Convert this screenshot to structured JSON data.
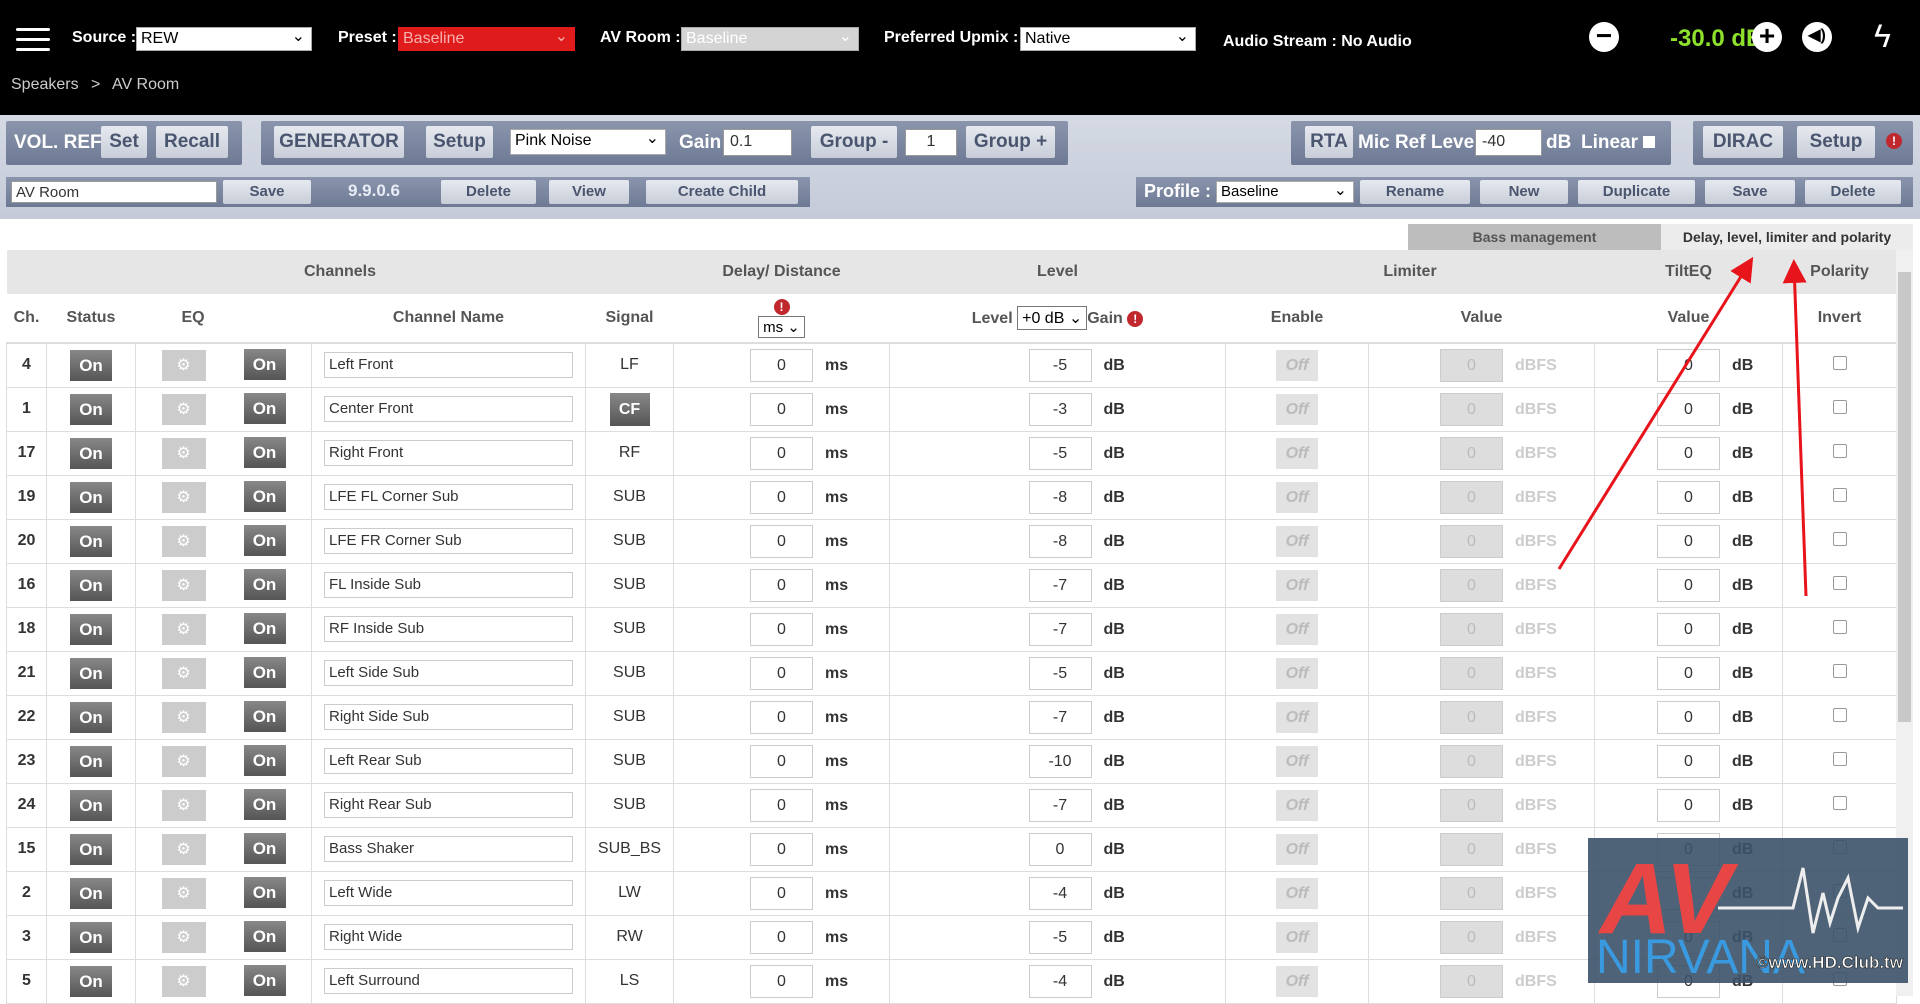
{
  "header": {
    "source_label": "Source :",
    "source": "REW",
    "preset_label": "Preset :",
    "preset": "Baseline",
    "av_room_label": "AV Room :",
    "av_room": "Baseline",
    "upmix_label": "Preferred Upmix :",
    "upmix": "Native",
    "audio_stream": "Audio Stream : No Audio",
    "volume": "-30.0 dB",
    "minus": "−",
    "plus": "+"
  },
  "breadcrumb": {
    "root": "Speakers",
    "sep": ">",
    "current": "AV Room"
  },
  "toolbar": {
    "vol_ref": "VOL. REF",
    "set": "Set",
    "recall": "Recall",
    "generator": "GENERATOR",
    "gen_setup": "Setup",
    "noise": "Pink Noise",
    "gain_label": "Gain",
    "gain": "0.1",
    "group_minus": "Group -",
    "group": "1",
    "group_plus": "Group +",
    "rta": "RTA",
    "mic_ref_label": "Mic Ref Level",
    "mic_ref": "-40",
    "db": "dB",
    "linear": "Linear",
    "dirac": "DIRAC",
    "dirac_setup": "Setup",
    "room_name": "AV Room",
    "save": "Save",
    "version": "9.9.0.6",
    "delete": "Delete",
    "view": "View",
    "create_child": "Create Child",
    "profile_label": "Profile :",
    "profile": "Baseline",
    "rename": "Rename",
    "new": "New",
    "duplicate": "Duplicate",
    "profile_save": "Save",
    "profile_delete": "Delete"
  },
  "tabs": {
    "bass": "Bass management",
    "delay": "Delay, level, limiter and polarity"
  },
  "table": {
    "groups": {
      "channels": "Channels",
      "delay": "Delay/ Distance",
      "level": "Level",
      "limiter": "Limiter",
      "tilt": "TiltEQ",
      "polarity": "Polarity"
    },
    "cols": {
      "ch": "Ch.",
      "status": "Status",
      "eq": "EQ",
      "name": "Channel Name",
      "signal": "Signal",
      "delay_unit": "ms",
      "level": "Level",
      "level_sel": "+0 dB",
      "gain": "Gain",
      "enable": "Enable",
      "value": "Value",
      "tilt_value": "Value",
      "invert": "Invert"
    },
    "on": "On",
    "off": "Off",
    "ms": "ms",
    "db": "dB",
    "dbfs": "dBFS",
    "limiter_value": "0",
    "rows": [
      {
        "ch": "4",
        "name": "Left Front",
        "signal": "LF",
        "delay": "0",
        "level": "-5",
        "tilt": "0"
      },
      {
        "ch": "1",
        "name": "Center Front",
        "signal": "CF",
        "signal_button": true,
        "delay": "0",
        "level": "-3",
        "tilt": "0"
      },
      {
        "ch": "17",
        "name": "Right Front",
        "signal": "RF",
        "delay": "0",
        "level": "-5",
        "tilt": "0"
      },
      {
        "ch": "19",
        "name": "LFE FL Corner Sub",
        "signal": "SUB",
        "delay": "0",
        "level": "-8",
        "tilt": "0"
      },
      {
        "ch": "20",
        "name": "LFE FR Corner Sub",
        "signal": "SUB",
        "delay": "0",
        "level": "-8",
        "tilt": "0"
      },
      {
        "ch": "16",
        "name": "FL Inside Sub",
        "signal": "SUB",
        "delay": "0",
        "level": "-7",
        "tilt": "0"
      },
      {
        "ch": "18",
        "name": "RF Inside Sub",
        "signal": "SUB",
        "delay": "0",
        "level": "-7",
        "tilt": "0"
      },
      {
        "ch": "21",
        "name": "Left Side Sub",
        "signal": "SUB",
        "delay": "0",
        "level": "-5",
        "tilt": "0"
      },
      {
        "ch": "22",
        "name": "Right Side Sub",
        "signal": "SUB",
        "delay": "0",
        "level": "-7",
        "tilt": "0"
      },
      {
        "ch": "23",
        "name": "Left Rear Sub",
        "signal": "SUB",
        "delay": "0",
        "level": "-10",
        "tilt": "0"
      },
      {
        "ch": "24",
        "name": "Right Rear Sub",
        "signal": "SUB",
        "delay": "0",
        "level": "-7",
        "tilt": "0"
      },
      {
        "ch": "15",
        "name": "Bass Shaker",
        "signal": "SUB_BS",
        "delay": "0",
        "level": "0",
        "tilt": "0"
      },
      {
        "ch": "2",
        "name": "Left Wide",
        "signal": "LW",
        "delay": "0",
        "level": "-4",
        "tilt": "0"
      },
      {
        "ch": "3",
        "name": "Right Wide",
        "signal": "RW",
        "delay": "0",
        "level": "-5",
        "tilt": "0"
      },
      {
        "ch": "5",
        "name": "Left Surround",
        "signal": "LS",
        "delay": "0",
        "level": "-4",
        "tilt": "0"
      }
    ]
  },
  "watermark": {
    "logo_av": "AV",
    "logo_nirvana": "NIRVANA",
    "credit": "©www.HD.Club.tw"
  },
  "colors": {
    "preset_bg": "#e01b1b",
    "volume": "#8de02c",
    "annotation_arrow": "#e8141b"
  }
}
